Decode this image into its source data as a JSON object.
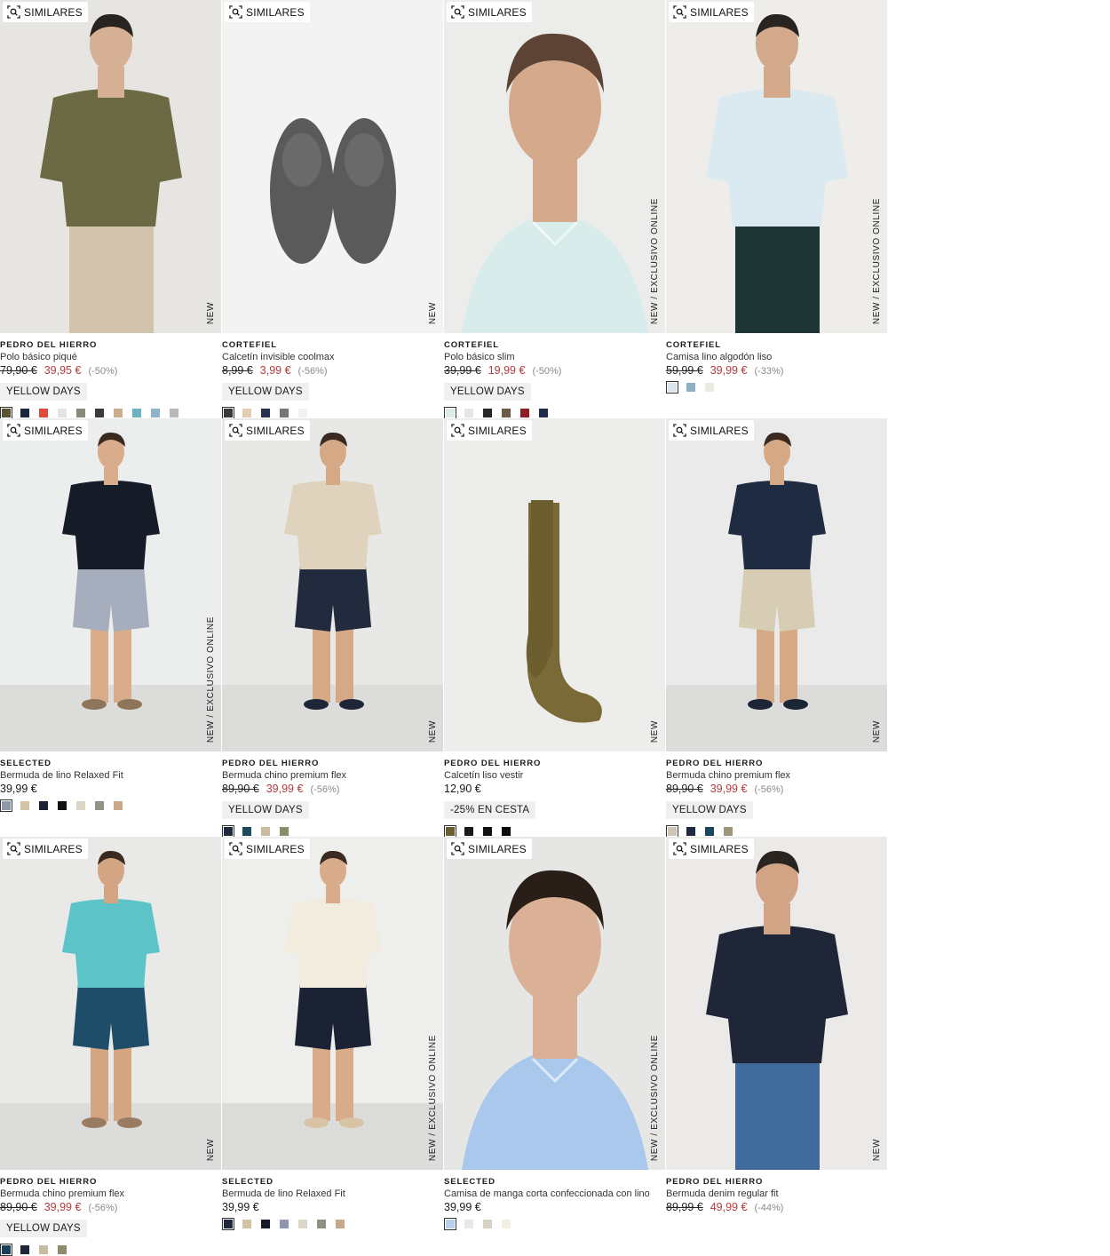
{
  "ui": {
    "similar_label": "SIMILARES"
  },
  "products": [
    {
      "brand": "PEDRO DEL HIERRO",
      "name": "Polo básico piqué",
      "old": "79,90 €",
      "price": "39,95 €",
      "disc": "(-50%)",
      "badge": "YELLOW DAYS",
      "tag": "NEW",
      "swatches": [
        "#5a5436",
        "#1c2540",
        "#e34a3e",
        "#e4e4e4",
        "#8a8878",
        "#3b3b3b",
        "#c9ad8f",
        "#6db2c0",
        "#8fb3c9",
        "#b8b8b8"
      ]
    },
    {
      "brand": "CORTEFIEL",
      "name": "Calcetín invisible coolmax",
      "old": "8,99 €",
      "price": "3,99 €",
      "disc": "(-56%)",
      "badge": "YELLOW DAYS",
      "tag": "NEW",
      "swatches": [
        "#3a3a3a",
        "#e1cdb2",
        "#24314e",
        "#757575",
        "#f1f1f1"
      ]
    },
    {
      "brand": "CORTEFIEL",
      "name": "Polo básico slim",
      "old": "39,99 €",
      "price": "19,99 €",
      "disc": "(-50%)",
      "badge": "YELLOW DAYS",
      "tag": "NEW  /  EXCLUSIVO ONLINE",
      "swatches": [
        "#ddeaea",
        "#e6e6e6",
        "#262626",
        "#6a5a46",
        "#8e1d24",
        "#1e2c4a"
      ]
    },
    {
      "brand": "CORTEFIEL",
      "name": "Camisa lino algodón liso",
      "old": "59,99 €",
      "price": "39,99 €",
      "disc": "(-33%)",
      "badge": "",
      "tag": "NEW  /  EXCLUSIVO ONLINE",
      "swatches": [
        "#dbe6ec",
        "#8eb0c2",
        "#ecebe3"
      ]
    },
    {
      "brand": "SELECTED",
      "name": "Bermuda de lino Relaxed Fit",
      "old": "",
      "price": "39,99 €",
      "disc": "",
      "badge": "",
      "tag": "NEW  /  EXCLUSIVO ONLINE",
      "swatches": [
        "#8d98a8",
        "#d5c3a3",
        "#1e2435",
        "#111111",
        "#dcd6c8",
        "#8f9483",
        "#c9a98a"
      ]
    },
    {
      "brand": "PEDRO DEL HIERRO",
      "name": "Bermuda chino premium flex",
      "old": "89,90 €",
      "price": "39,99 €",
      "disc": "(-56%)",
      "badge": "YELLOW DAYS",
      "tag": "NEW",
      "swatches": [
        "#1f2a3d",
        "#1d4a5c",
        "#c8bca3",
        "#8e8a6c"
      ]
    },
    {
      "brand": "PEDRO DEL HIERRO",
      "name": "Calcetín liso vestir",
      "old": "",
      "price": "12,90 €",
      "disc": "",
      "badge": "-25% EN CESTA",
      "tag": "NEW",
      "swatches": [
        "#6b5f35",
        "#1a1a1a",
        "#111111",
        "#0a0a0a"
      ]
    },
    {
      "brand": "PEDRO DEL HIERRO",
      "name": "Bermuda chino premium flex",
      "old": "89,90 €",
      "price": "39,99 €",
      "disc": "(-56%)",
      "badge": "YELLOW DAYS",
      "tag": "NEW",
      "swatches": [
        "#cfc5b0",
        "#1e2a3f",
        "#1b4560",
        "#9d9679"
      ]
    },
    {
      "brand": "PEDRO DEL HIERRO",
      "name": "Bermuda chino premium flex",
      "old": "89,90 €",
      "price": "39,99 €",
      "disc": "(-56%)",
      "badge": "YELLOW DAYS",
      "tag": "NEW",
      "swatches": [
        "#1b3f58",
        "#1f2638",
        "#c7bca0",
        "#8e8a6e"
      ]
    },
    {
      "brand": "SELECTED",
      "name": "Bermuda de lino Relaxed Fit",
      "old": "",
      "price": "39,99 €",
      "disc": "",
      "badge": "",
      "tag": "NEW  /  EXCLUSIVO ONLINE",
      "swatches": [
        "#1f2a3c",
        "#d4c2a4",
        "#161b2b",
        "#8e96ab",
        "#dcd6c6",
        "#8d9180",
        "#c9a88a"
      ]
    },
    {
      "brand": "SELECTED",
      "name": "Camisa de manga corta confeccionada con lino",
      "old": "",
      "price": "39,99 €",
      "disc": "",
      "badge": "",
      "tag": "NEW  /  EXCLUSIVO ONLINE",
      "swatches": [
        "#b9d0ec",
        "#e9e9e9",
        "#d7d2c2",
        "#f5efe2"
      ]
    },
    {
      "brand": "PEDRO DEL HIERRO",
      "name": "Bermuda denim regular fit",
      "old": "89,99 €",
      "price": "49,99 €",
      "disc": "(-44%)",
      "badge": "",
      "tag": "NEW",
      "swatches": []
    }
  ]
}
